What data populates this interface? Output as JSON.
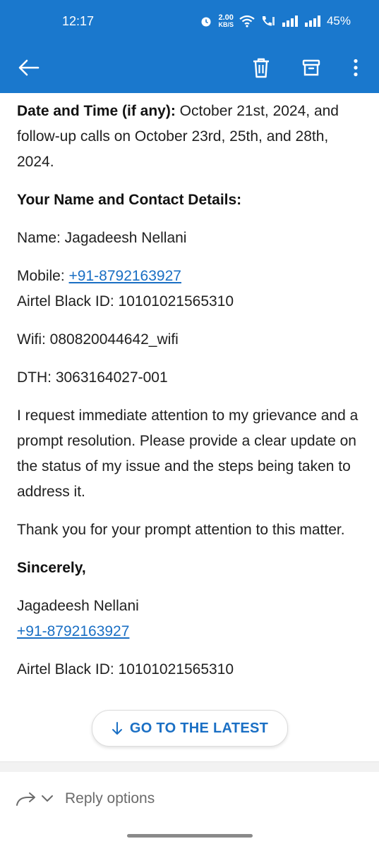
{
  "status_bar": {
    "time": "12:17",
    "net_speed_value": "2.00",
    "net_speed_unit": "KB/S",
    "battery": "45%"
  },
  "toolbar": {
    "back_icon": "arrow-left-icon",
    "delete_icon": "trash-icon",
    "archive_icon": "archive-icon",
    "more_icon": "more-vertical-icon"
  },
  "email": {
    "date_label": "Date and Time (if any):",
    "date_text": "October 21st, 2024, and follow-up calls on October 23rd, 25th, and 28th, 2024.",
    "contact_heading": "Your Name and Contact Details:",
    "name_line": "Name: Jagadeesh Nellani",
    "mobile_label": "Mobile:",
    "mobile_number": "+91-8792163927",
    "airtel_id_line": "Airtel Black ID: 10101021565310",
    "wifi_line": "Wifi: 080820044642_wifi",
    "dth_line": "DTH: 3063164027-001",
    "request_paragraph": "I request immediate attention to my grievance and a prompt resolution. Please provide a clear update on the status of my issue and the steps being taken to address it.",
    "thanks_paragraph": "Thank you for your prompt attention to this matter.",
    "signoff": "Sincerely,",
    "sig_name": "Jagadeesh Nellani",
    "sig_phone": "+91-8792163927",
    "sig_airtel_id": "Airtel Black ID: 10101021565310"
  },
  "go_latest": {
    "label": "GO TO THE LATEST",
    "icon": "arrow-down-icon"
  },
  "footer": {
    "reply_label": "Reply options",
    "reply_icon": "reply-arrow-icon",
    "chevron_icon": "chevron-down-icon"
  },
  "colors": {
    "brand": "#1a78cd",
    "link": "#1a6fc4"
  }
}
